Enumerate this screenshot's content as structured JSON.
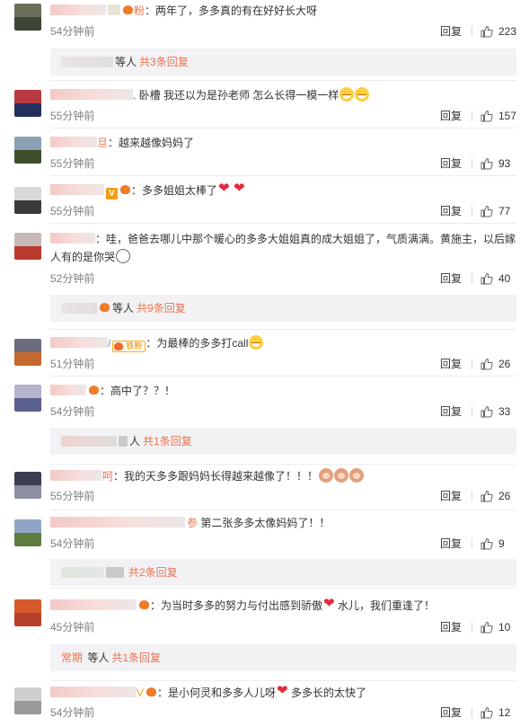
{
  "comments": [
    {
      "badges": [
        "fan-small"
      ],
      "name_tail": "粉",
      "text": "：两年了，多多真的有在好好长大呀",
      "emojis": [],
      "time": "54分钟前",
      "reply": "回复",
      "likes": "223",
      "avatar_colors": [
        "#6a6f5a",
        "#3e4437"
      ],
      "thread": {
        "suffix": "等人",
        "link": "共3条回复"
      }
    },
    {
      "badges": [],
      "name_tail": "",
      "text": "卧槽 我还以为是孙老师 怎么长得一模一样",
      "emojis": [
        "laugh",
        "laugh"
      ],
      "time": "55分钟前",
      "reply": "回复",
      "likes": "157",
      "avatar_colors": [
        "#b83a3e",
        "#23305f"
      ]
    },
    {
      "badges": [],
      "name_tail": "旦",
      "text": "：越来越像妈妈了",
      "emojis": [],
      "time": "55分钟前",
      "reply": "回复",
      "likes": "93",
      "avatar_colors": [
        "#8aa1b5",
        "#3f4d2c"
      ]
    },
    {
      "badges": [
        "v",
        "fan-small"
      ],
      "name_tail": "",
      "text": "：多多姐姐太棒了",
      "emojis": [
        "heart",
        "heart"
      ],
      "time": "55分钟前",
      "reply": "回复",
      "likes": "77",
      "avatar_colors": [
        "#d8d8d8",
        "#3b3b3b"
      ]
    },
    {
      "badges": [],
      "name_tail": "",
      "text": "：哇，爸爸去哪儿中那个暖心的多多大姐姐真的成大姐姐了，气质满满。黄施主，以后嫁人有的是你哭",
      "emojis": [
        "ghost"
      ],
      "time": "52分钟前",
      "reply": "回复",
      "likes": "40",
      "avatar_colors": [
        "#c6b9b7",
        "#b83a2c"
      ],
      "thread": {
        "suffix": "等人",
        "link": "共9条回复"
      }
    },
    {
      "badges": [
        "fan"
      ],
      "fan_label": "铁粉",
      "name_tail": "",
      "text": "：为最棒的多多打call",
      "emojis": [
        "laugh"
      ],
      "time": "51分钟前",
      "reply": "回复",
      "likes": "26",
      "avatar_colors": [
        "#6b6d7d",
        "#c4682e"
      ]
    },
    {
      "badges": [
        "fan-small"
      ],
      "name_tail": "",
      "text": "：高中了？？！",
      "emojis": [],
      "time": "54分钟前",
      "reply": "回复",
      "likes": "33",
      "avatar_colors": [
        "#b6b3cf",
        "#5b5f8d"
      ],
      "thread": {
        "suffix": "人",
        "link": "共1条回复"
      }
    },
    {
      "badges": [],
      "name_tail": "呵",
      "text": "：我的天多多跟妈妈长得越来越像了！！！",
      "emojis": [
        "monkey",
        "monkey",
        "monkey"
      ],
      "time": "55分钟前",
      "reply": "回复",
      "likes": "26",
      "avatar_colors": [
        "#3b3e52",
        "#8d8fa2"
      ]
    },
    {
      "badges": [],
      "name_tail": "",
      "text": "第二张多多太像妈妈了！！",
      "emojis": [],
      "time": "54分钟前",
      "reply": "回复",
      "likes": "9",
      "avatar_colors": [
        "#8fa7c4",
        "#5d7d3f"
      ],
      "thread": {
        "suffix": "",
        "link": "共2条回复"
      }
    },
    {
      "badges": [
        "fan-small"
      ],
      "name_tail": "",
      "text": "：为当时多多的努力与付出感到骄傲",
      "text2": "水儿，我们重逢了！",
      "emojis": [
        "heart"
      ],
      "time": "45分钟前",
      "reply": "回复",
      "likes": "10",
      "avatar_colors": [
        "#d75a2a",
        "#b6402a"
      ],
      "thread": {
        "name": "常期",
        "suffix": "等人",
        "link": "共1条回复"
      }
    },
    {
      "badges": [
        "v-line",
        "fan-small"
      ],
      "name_tail": "",
      "text": "：是小何灵和多多人儿呀",
      "text2": "多多长的太快了",
      "emojis": [
        "heart"
      ],
      "time": "54分钟前",
      "reply": "回复",
      "likes": "12",
      "avatar_colors": [
        "#cfcfcf",
        "#9a9a9a"
      ]
    }
  ],
  "colors": {
    "accent": "#eb7350",
    "text": "#333333",
    "muted": "#808080",
    "reply_bg": "#f2f2f5"
  },
  "icons": {
    "like": "thumbs-up-icon"
  }
}
